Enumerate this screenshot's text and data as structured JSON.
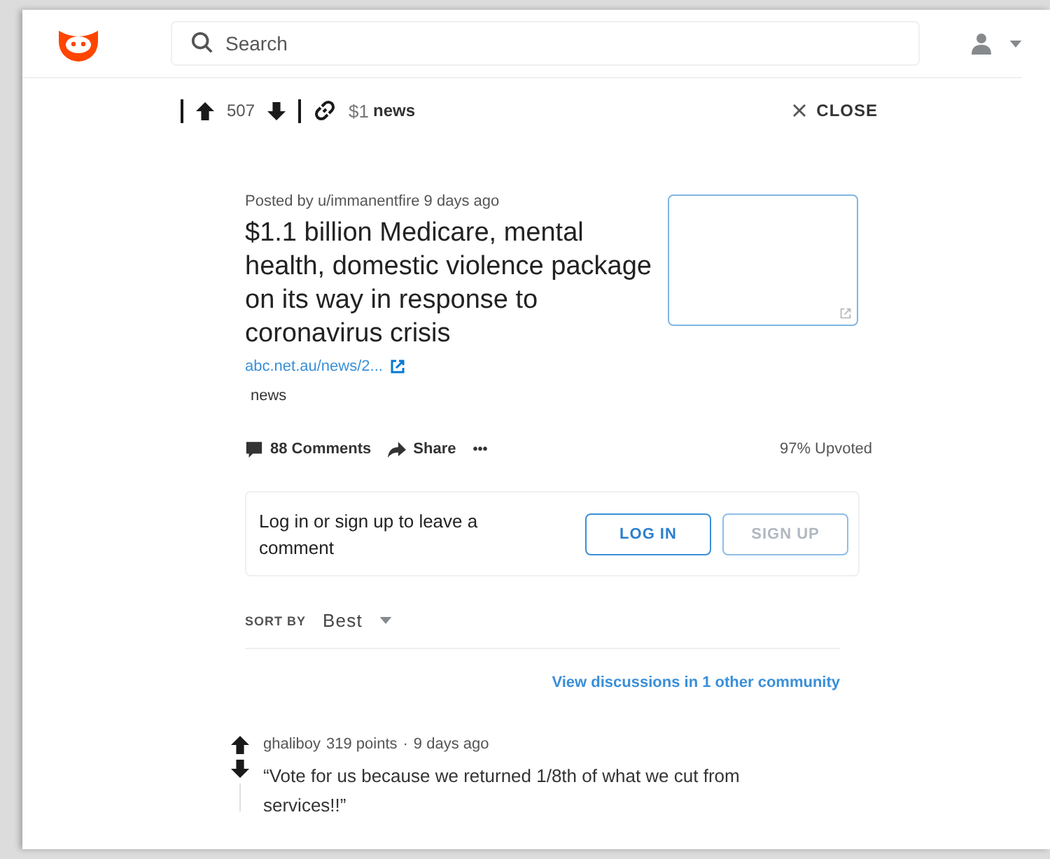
{
  "header": {
    "search": {
      "placeholder": "Search"
    }
  },
  "post_bar": {
    "score": "507",
    "subreddit_prefix": "$1",
    "subreddit": "news",
    "close": "CLOSE"
  },
  "post": {
    "meta": "Posted by u/immanentfire 9 days ago",
    "title": "$1.1 billion Medicare, mental health, domestic violence package on its way in response to coronavirus crisis",
    "link": "abc.net.au/news/2...",
    "flair": "news",
    "comments": "88 Comments",
    "share": "Share",
    "more": "•••",
    "upvoted": "97% Upvoted"
  },
  "login_prompt": {
    "text": "Log in or sign up to leave a comment",
    "buttons": [
      {
        "label": "LOG IN",
        "kind": "primary"
      },
      {
        "label": "SIGN UP",
        "kind": "secondary"
      }
    ]
  },
  "sort": {
    "label": "SORT BY",
    "value": "Best"
  },
  "other_discussions": "View discussions in 1 other community",
  "comments": [
    {
      "author": "ghaliboy",
      "points": "319 points",
      "separator": "·",
      "time": "9 days ago",
      "text": "“Vote for us because we returned 1/8th of what we cut from services!!”"
    }
  ]
}
